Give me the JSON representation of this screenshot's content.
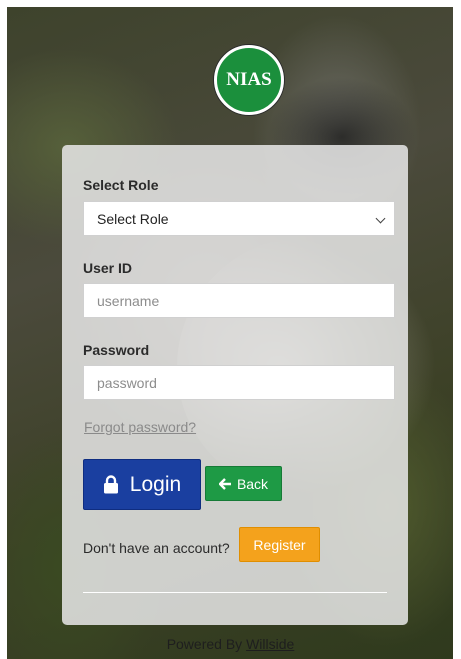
{
  "logo": {
    "text": "NIAS"
  },
  "form": {
    "role_label": "Select Role",
    "role_select": {
      "selected": "Select Role"
    },
    "userid_label": "User ID",
    "username_placeholder": "username",
    "password_label": "Password",
    "password_placeholder": "password",
    "forgot_link": "Forgot password?"
  },
  "buttons": {
    "login_label": "Login",
    "back_label": "Back",
    "register_label": "Register"
  },
  "account_text": "Don't have an account?",
  "footer": {
    "powered_by": "Powered By",
    "company_link": "Willside"
  },
  "colors": {
    "login": "#1a3fa0",
    "back": "#1e9a45",
    "register": "#f4a21c",
    "logo": "#1b8f3c"
  },
  "icons": {
    "login": "lock-icon",
    "back": "arrow-left-icon",
    "select": "chevron-down-icon"
  }
}
